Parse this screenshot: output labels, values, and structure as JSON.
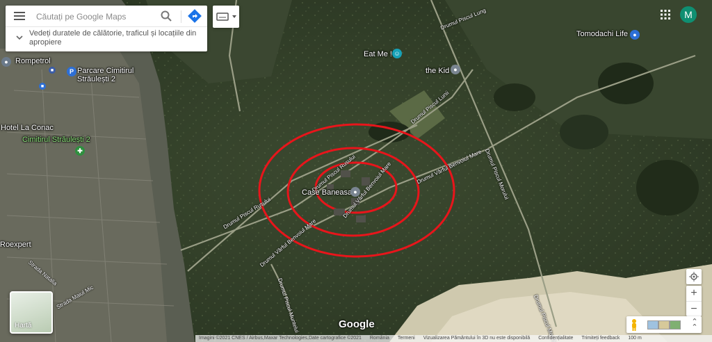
{
  "search": {
    "placeholder": "Căutați pe Google Maps",
    "hint": "Vedeți duratele de călătorie, traficul și locațiile din apropiere"
  },
  "account": {
    "initial": "M",
    "color": "#0f8f72"
  },
  "map": {
    "places": {
      "rompetrol": "Rompetrol",
      "parking": "Parcare Cimitirul Străulești 2",
      "hotel": "Hotel La Conac",
      "cemetery": "Cimitirul Străulești 2",
      "eat_me": "Eat Me !",
      "the_kid": "the Kid",
      "tomodachi": "Tomodachi Life",
      "case_baneasa": "Case Baneasa",
      "roexpert": "Roexpert"
    },
    "roads": {
      "piscul_lung": "Drumul Piscul Lung",
      "piscul_lunii": "Drumul Piscul Lunii",
      "piscul_rusului_top": "Drumul Piscul Rusului",
      "piscul_rusului_left": "Drumul Piscul Rusului",
      "varful_benvoiu_mare_right": "Drumul Vârful Benvoiul Mare",
      "varful_benvoiu_mare_mid": "Drumul Vârful Benvoiul Mare",
      "varful_benvoiu_mare_bottom": "Drumul Vârful Benvoiul Mare",
      "piscul_moruli_right": "Drumul Piscul Morului",
      "piscul_moruli_bottom": "Drumul Piscul Morului",
      "piscul_muntelui": "Drumul Piscul Muntelui",
      "strada_natalia": "Strada Natalia",
      "strada_maxiul_mic": "Strada Maiul Mic"
    },
    "circle_color": "#e8151b",
    "google_logo": "Google"
  },
  "layer_toggle": {
    "label": "Hartă"
  },
  "footer": {
    "imagery": "Imagini ©2021 CNES / Airbus,Maxar Technologies,Date cartografice ©2021",
    "country": "România",
    "terms": "Termeni",
    "message": "Vizualizarea Pământului în 3D nu este disponibilă",
    "privacy": "Confidențialitate",
    "feedback": "Trimiteți feedback",
    "scale": "100 m"
  },
  "icons": {
    "menu": "menu-icon",
    "search": "search-icon",
    "directions": "directions-icon",
    "keyboard": "keyboard-icon",
    "apps": "apps-icon",
    "locate": "locate-icon",
    "pegman": "pegman-icon"
  }
}
